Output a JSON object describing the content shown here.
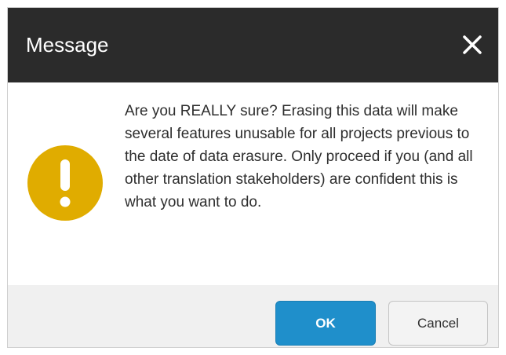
{
  "dialog": {
    "title": "Message",
    "message": "Are you REALLY sure? Erasing this data will make several features unusable for all projects previous to the date of data erasure. Only proceed if you (and all other translation stakeholders) are confident this is what you want to do.",
    "icon": "warning-icon",
    "ok_label": "OK",
    "cancel_label": "Cancel"
  },
  "colors": {
    "titlebar": "#2b2b2b",
    "warning": "#e0ac00",
    "ok_button": "#1f8fcb",
    "footer": "#f0f0f0"
  }
}
